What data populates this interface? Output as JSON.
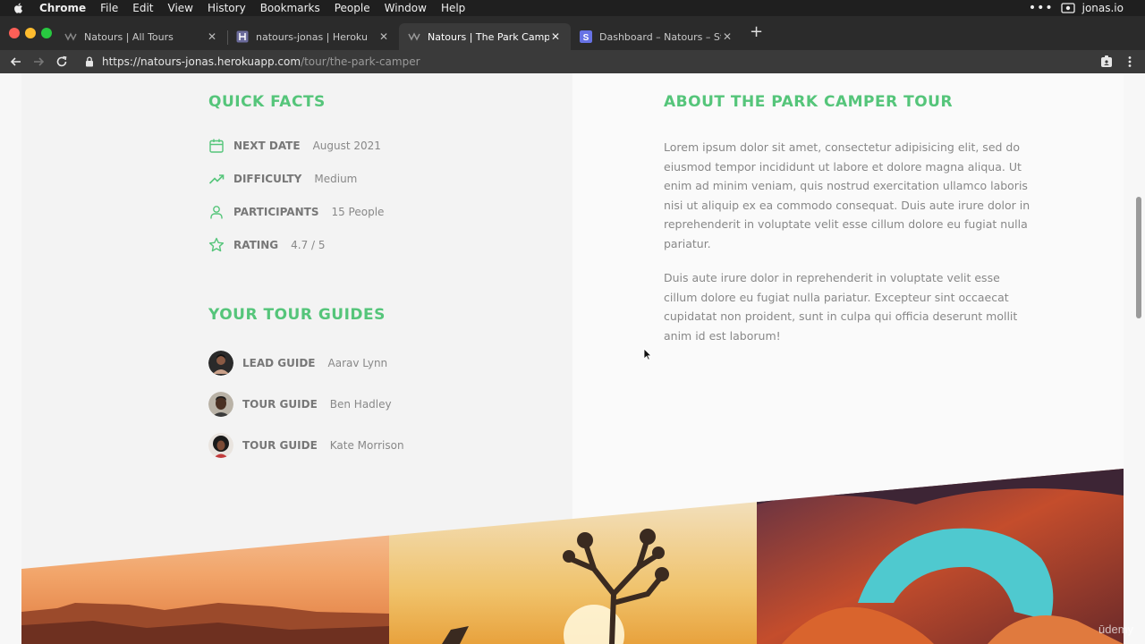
{
  "menubar": {
    "items": [
      "Chrome",
      "File",
      "Edit",
      "View",
      "History",
      "Bookmarks",
      "People",
      "Window",
      "Help"
    ],
    "account": "jonas.io"
  },
  "tabs": [
    {
      "title": "Natours | All Tours"
    },
    {
      "title": "natours-jonas | Heroku"
    },
    {
      "title": "Natours | The Park Camper To"
    },
    {
      "title": "Dashboard – Natours – Stripe"
    }
  ],
  "address": {
    "host": "https://natours-jonas.herokuapp.com",
    "path": "/tour/the-park-camper"
  },
  "quick_facts": {
    "heading": "QUICK FACTS",
    "items": [
      {
        "icon": "calendar-icon",
        "label": "NEXT DATE",
        "value": "August 2021"
      },
      {
        "icon": "trending-up-icon",
        "label": "DIFFICULTY",
        "value": "Medium"
      },
      {
        "icon": "user-icon",
        "label": "PARTICIPANTS",
        "value": "15 People"
      },
      {
        "icon": "star-icon",
        "label": "RATING",
        "value": "4.7 / 5"
      }
    ]
  },
  "guides": {
    "heading": "YOUR TOUR GUIDES",
    "items": [
      {
        "role": "LEAD GUIDE",
        "name": "Aarav Lynn"
      },
      {
        "role": "TOUR GUIDE",
        "name": "Ben Hadley"
      },
      {
        "role": "TOUR GUIDE",
        "name": "Kate Morrison"
      }
    ]
  },
  "about": {
    "heading": "ABOUT THE PARK CAMPER TOUR",
    "paragraphs": [
      "Lorem ipsum dolor sit amet, consectetur adipisicing elit, sed do eiusmod tempor incididunt ut labore et dolore magna aliqua. Ut enim ad minim veniam, quis nostrud exercitation ullamco laboris nisi ut aliquip ex ea commodo consequat. Duis aute irure dolor in reprehenderit in voluptate velit esse cillum dolore eu fugiat nulla pariatur.",
      "Duis aute irure dolor in reprehenderit in voluptate velit esse cillum dolore eu fugiat nulla pariatur. Excepteur sint occaecat cupidatat non proident, sunt in culpa qui officia deserunt mollit anim id est laborum!"
    ]
  },
  "watermark": "ūdemy",
  "colors": {
    "accent": "#55c57a"
  }
}
